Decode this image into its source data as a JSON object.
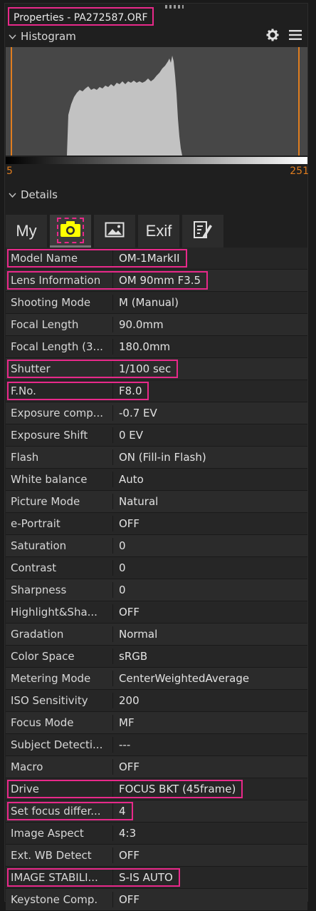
{
  "window": {
    "title": "Properties - PA272587.ORF"
  },
  "histogram": {
    "section_label": "Histogram",
    "min_label": "5",
    "max_label": "251",
    "icons": [
      "gear-icon",
      "menu-icon"
    ]
  },
  "details": {
    "section_label": "Details",
    "tabs": [
      {
        "label": "My"
      },
      {
        "label": "",
        "icon": "camera-icon",
        "active": true
      },
      {
        "label": "",
        "icon": "image-icon"
      },
      {
        "label": "Exif"
      },
      {
        "label": "",
        "icon": "edit-icon"
      }
    ]
  },
  "properties": [
    {
      "label": "Model Name",
      "value": "OM-1MarkII",
      "highlighted": true
    },
    {
      "label": "Lens Information",
      "value": "OM 90mm F3.5",
      "highlighted": true
    },
    {
      "label": "Shooting Mode",
      "value": "M (Manual)"
    },
    {
      "label": "Focal Length",
      "value": "90.0mm"
    },
    {
      "label": "Focal Length (3...",
      "value": "180.0mm"
    },
    {
      "label": "Shutter",
      "value": "1/100 sec",
      "highlighted": true
    },
    {
      "label": "F.No.",
      "value": "F8.0",
      "highlighted": true
    },
    {
      "label": "Exposure comp...",
      "value": "-0.7 EV"
    },
    {
      "label": "Exposure Shift",
      "value": "0 EV"
    },
    {
      "label": "Flash",
      "value": "ON (Fill-in Flash)"
    },
    {
      "label": "White balance",
      "value": "Auto"
    },
    {
      "label": "Picture Mode",
      "value": "Natural"
    },
    {
      "label": "e-Portrait",
      "value": "OFF"
    },
    {
      "label": "Saturation",
      "value": "0"
    },
    {
      "label": "Contrast",
      "value": "0"
    },
    {
      "label": "Sharpness",
      "value": "0"
    },
    {
      "label": "Highlight&Sha...",
      "value": "OFF"
    },
    {
      "label": "Gradation",
      "value": "Normal"
    },
    {
      "label": "Color Space",
      "value": "sRGB"
    },
    {
      "label": "Metering Mode",
      "value": "CenterWeightedAverage"
    },
    {
      "label": "ISO Sensitivity",
      "value": "200"
    },
    {
      "label": "Focus Mode",
      "value": "MF"
    },
    {
      "label": "Subject Detecti...",
      "value": "---"
    },
    {
      "label": "Macro",
      "value": "OFF"
    },
    {
      "label": "Drive",
      "value": "FOCUS BKT (45frame)",
      "highlighted": true
    },
    {
      "label": "Set focus differ...",
      "value": "4",
      "highlighted": true
    },
    {
      "label": "Image Aspect",
      "value": "4:3"
    },
    {
      "label": "Ext. WB Detect",
      "value": "OFF"
    },
    {
      "label": "IMAGE STABILI...",
      "value": "S-IS AUTO",
      "highlighted": true
    },
    {
      "label": "Keystone Comp.",
      "value": "OFF"
    }
  ],
  "colors": {
    "highlight": "#e8298a",
    "accent_orange": "#e07d1f",
    "active_icon": "#ffff00"
  }
}
